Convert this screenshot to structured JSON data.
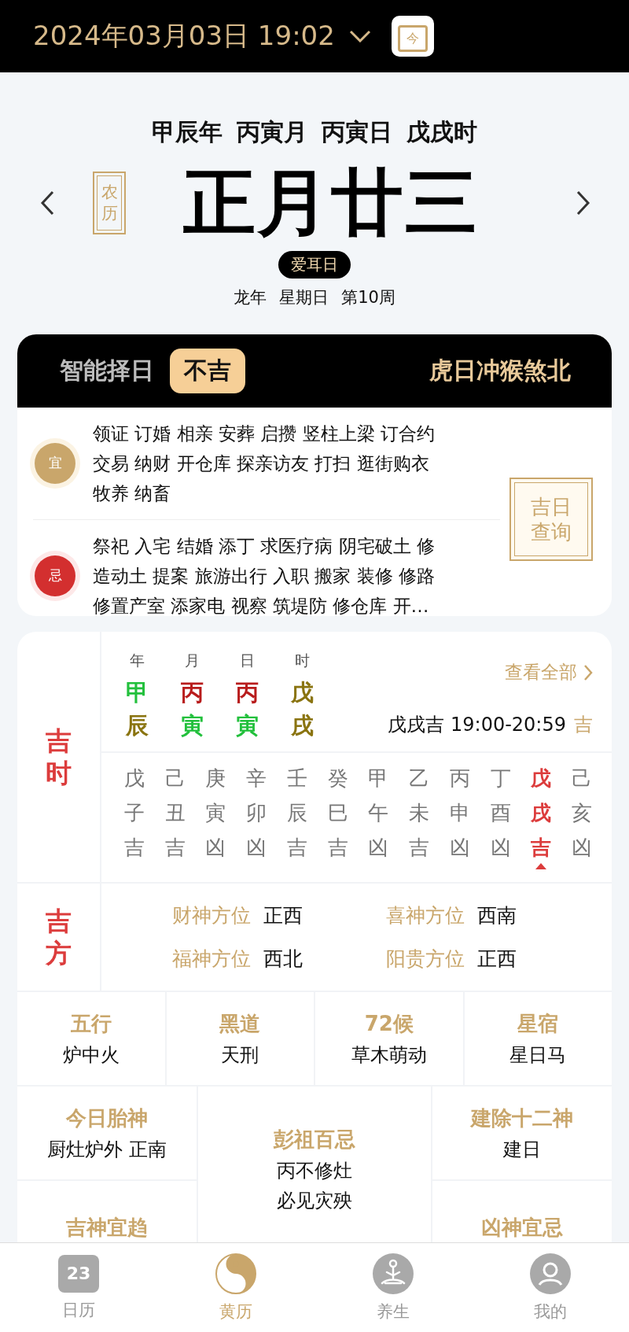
{
  "header": {
    "date_time": "2024年03月03日 19:02",
    "today_label": "今"
  },
  "ganzhi": [
    "甲辰年",
    "丙寅月",
    "丙寅日",
    "戊戌时"
  ],
  "lunar": {
    "badge_label": "农历",
    "date": "正月廿三",
    "festival": "爱耳日",
    "info": [
      "龙年",
      "星期日",
      "第10周"
    ]
  },
  "almanac": {
    "title": "智能择日",
    "verdict": "不吉",
    "clash": "虎日冲猴煞北",
    "entries": [
      {
        "kind": "yi",
        "label": "宜",
        "lines": [
          "领证 订婚 相亲 安葬 启攒 竖柱上梁 订合约",
          "交易 纳财 开仓库 探亲访友 打扫 逛街购衣",
          "牧养 纳畜"
        ]
      },
      {
        "kind": "ji",
        "label": "忌",
        "lines": [
          "祭祀 入宅 结婚 添丁 求医疗病 阴宅破土 修",
          "造动土 提案 旅游出行 入职 搬家 装修 修路",
          "修置产室 添家电 视察 筑堤防 修仓库 开…"
        ]
      }
    ],
    "query_button": "吉日查询"
  },
  "jishi": {
    "label": "吉时",
    "pillars": [
      {
        "label": "年",
        "stem": {
          "text": "甲",
          "color": "#22c03c"
        },
        "branch": {
          "text": "辰",
          "color": "#8a7410"
        }
      },
      {
        "label": "月",
        "stem": {
          "text": "丙",
          "color": "#b81c1c"
        },
        "branch": {
          "text": "寅",
          "color": "#22c03c"
        }
      },
      {
        "label": "日",
        "stem": {
          "text": "丙",
          "color": "#b81c1c"
        },
        "branch": {
          "text": "寅",
          "color": "#22c03c"
        }
      },
      {
        "label": "时",
        "stem": {
          "text": "戊",
          "color": "#8a7410"
        },
        "branch": {
          "text": "戌",
          "color": "#8a7410"
        }
      }
    ],
    "view_all": "查看全部",
    "current": "戊戌吉 19:00-20:59",
    "current_mark": "吉",
    "hours": [
      {
        "stem": "戊",
        "branch": "子",
        "luck": "吉",
        "selected": false
      },
      {
        "stem": "己",
        "branch": "丑",
        "luck": "吉",
        "selected": false
      },
      {
        "stem": "庚",
        "branch": "寅",
        "luck": "凶",
        "selected": false
      },
      {
        "stem": "辛",
        "branch": "卯",
        "luck": "凶",
        "selected": false
      },
      {
        "stem": "壬",
        "branch": "辰",
        "luck": "吉",
        "selected": false
      },
      {
        "stem": "癸",
        "branch": "巳",
        "luck": "吉",
        "selected": false
      },
      {
        "stem": "甲",
        "branch": "午",
        "luck": "凶",
        "selected": false
      },
      {
        "stem": "乙",
        "branch": "未",
        "luck": "吉",
        "selected": false
      },
      {
        "stem": "丙",
        "branch": "申",
        "luck": "凶",
        "selected": false
      },
      {
        "stem": "丁",
        "branch": "酉",
        "luck": "凶",
        "selected": false
      },
      {
        "stem": "戊",
        "branch": "戌",
        "luck": "吉",
        "selected": true
      },
      {
        "stem": "己",
        "branch": "亥",
        "luck": "凶",
        "selected": false
      }
    ]
  },
  "jifang": {
    "label": "吉方",
    "items": [
      {
        "label": "财神方位",
        "value": "正西"
      },
      {
        "label": "喜神方位",
        "value": "西南"
      },
      {
        "label": "福神方位",
        "value": "西北"
      },
      {
        "label": "阳贵方位",
        "value": "正西"
      }
    ]
  },
  "details_row": [
    {
      "title": "五行",
      "value": "炉中火"
    },
    {
      "title": "黑道",
      "value": "天刑"
    },
    {
      "title": "72候",
      "value": "草木萌动"
    },
    {
      "title": "星宿",
      "value": "星日马"
    }
  ],
  "details_left": [
    {
      "title": "今日胎神",
      "value": "厨灶炉外 正南"
    },
    {
      "title": "吉神宜趋"
    }
  ],
  "details_middle": {
    "title": "彭祖百忌",
    "lines": [
      "丙不修灶",
      "必见灾殃"
    ]
  },
  "details_right": [
    {
      "title": "建除十二神",
      "value": "建日"
    },
    {
      "title": "凶神宜忌"
    }
  ],
  "tabs": [
    {
      "kind": "calendar",
      "label": "日历",
      "icon_text": "23",
      "selected": false
    },
    {
      "kind": "yinyang",
      "label": "黄历",
      "selected": true
    },
    {
      "kind": "meditation",
      "label": "养生",
      "selected": false
    },
    {
      "kind": "profile",
      "label": "我的",
      "selected": false
    }
  ]
}
